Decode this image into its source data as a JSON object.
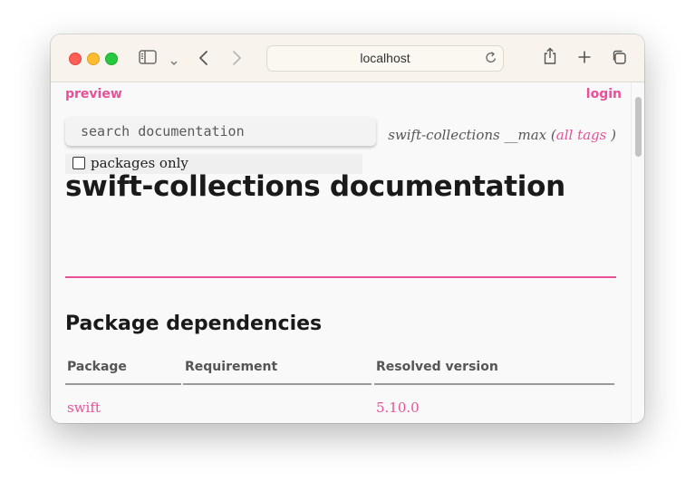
{
  "browser": {
    "url": "localhost"
  },
  "nav": {
    "preview_label": "preview",
    "login_label": "login"
  },
  "search": {
    "placeholder": "search documentation",
    "packages_only_label": "packages only"
  },
  "version": {
    "package": "swift-collections",
    "ref": "__max",
    "open_paren": "(",
    "all_tags_label": "all tags",
    "close_paren": ")"
  },
  "page": {
    "title": "swift-collections documentation",
    "section_title": "Package dependencies"
  },
  "dependencies": {
    "headers": [
      "Package",
      "Requirement",
      "Resolved version"
    ],
    "rows": [
      {
        "package": "swift",
        "requirement": "",
        "resolved_version": "5.10.0"
      }
    ]
  },
  "colors": {
    "accent": "#e8509a",
    "titlebar": "#f8f4ed",
    "page_background": "#f9f9f9"
  }
}
